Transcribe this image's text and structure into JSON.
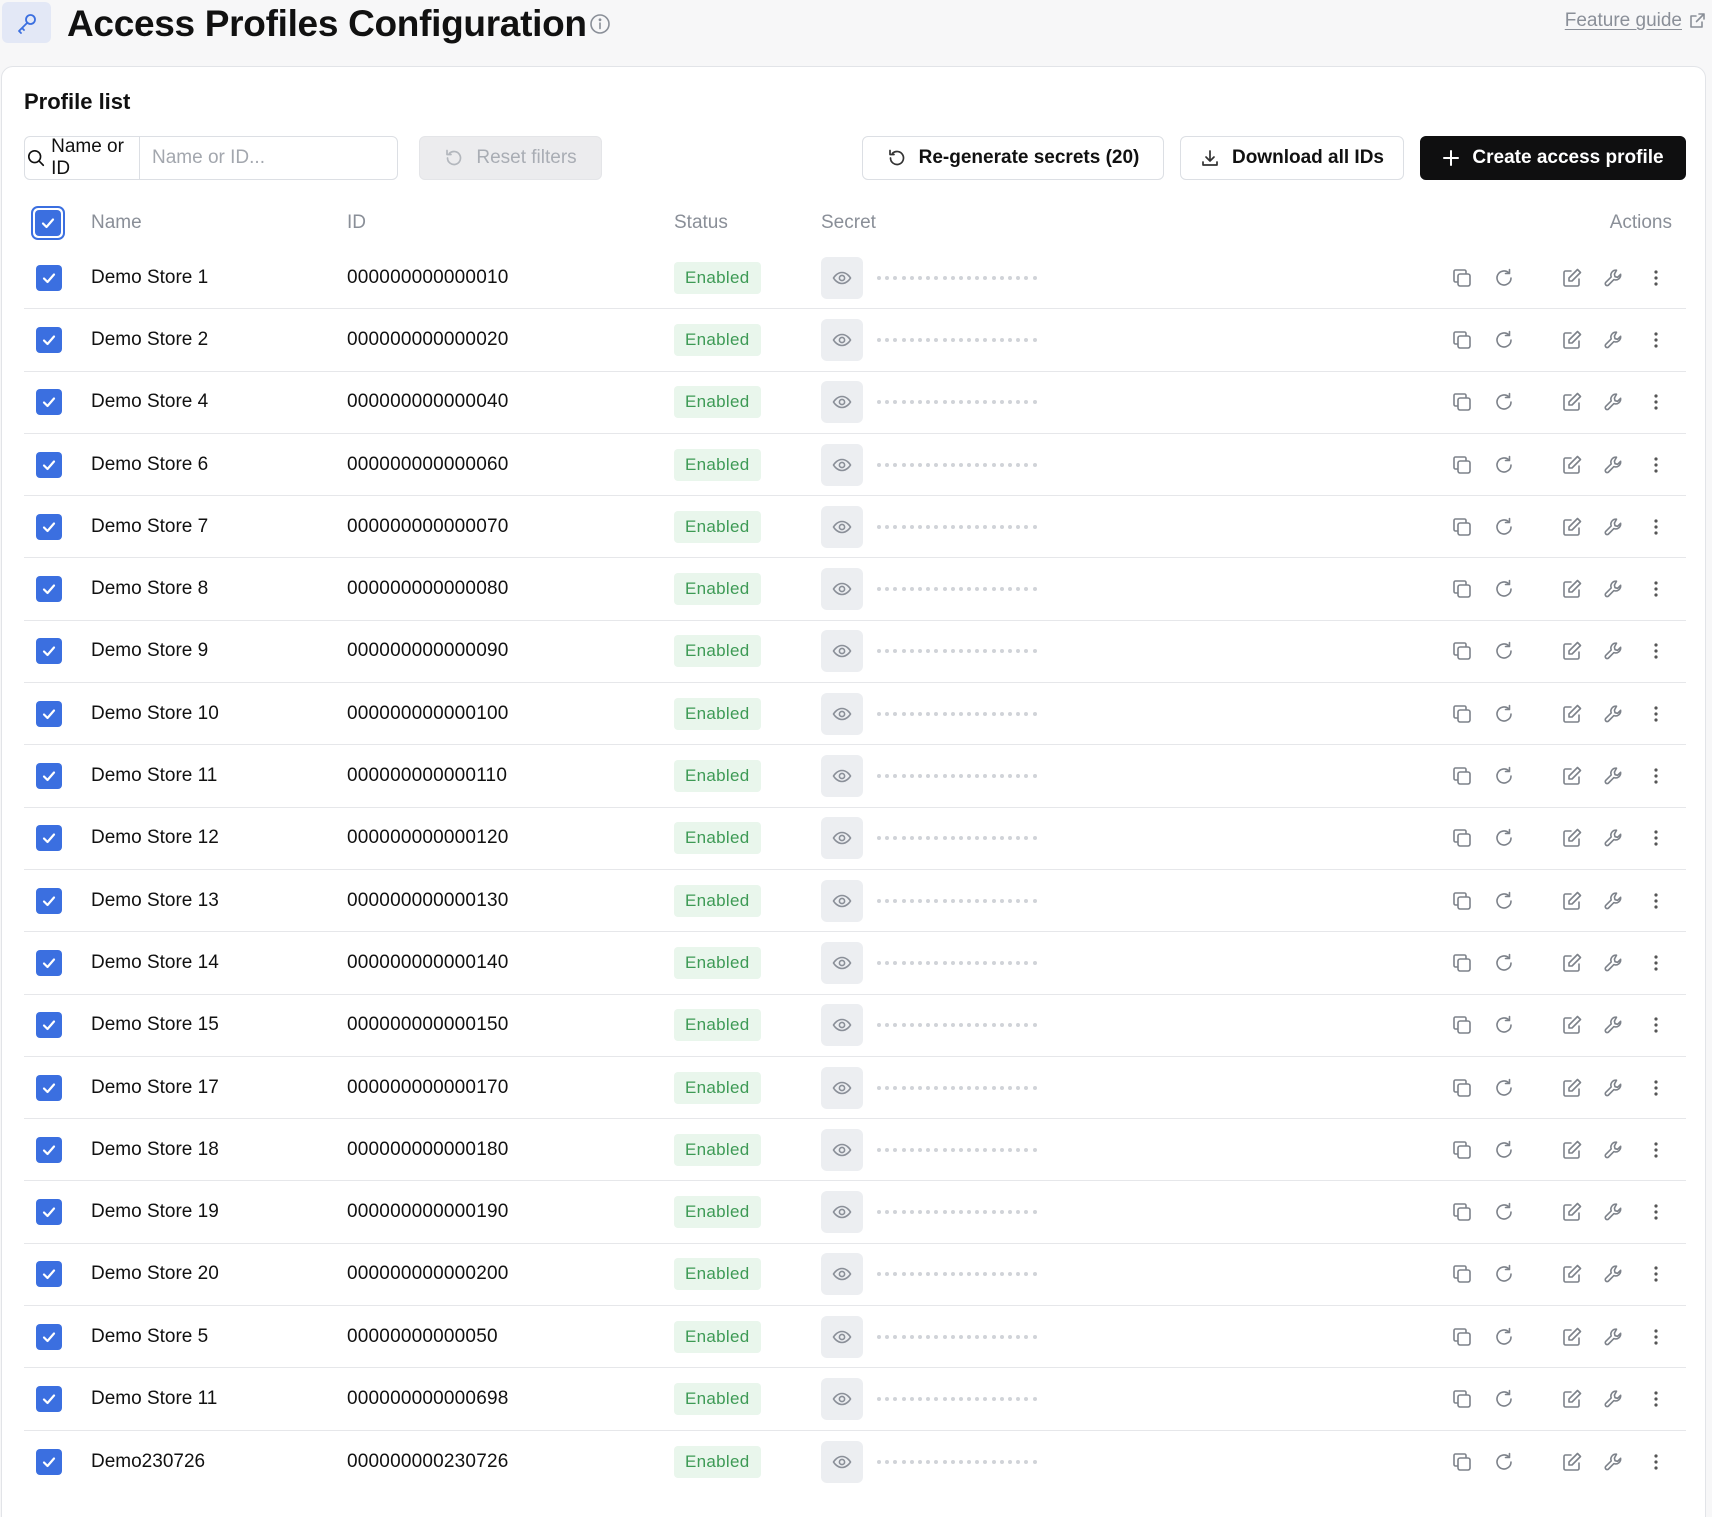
{
  "header": {
    "title": "Access Profiles Configuration",
    "feature_guide": "Feature guide"
  },
  "panel": {
    "title": "Profile list",
    "filter": {
      "type_label": "Name or ID",
      "placeholder": "Name or ID...",
      "value": ""
    },
    "buttons": {
      "reset": "Reset filters",
      "regenerate": "Re-generate secrets (20)",
      "download": "Download all IDs",
      "create": "Create access profile"
    }
  },
  "table": {
    "columns": {
      "name": "Name",
      "id": "ID",
      "status": "Status",
      "secret": "Secret",
      "actions": "Actions"
    },
    "rows": [
      {
        "name": "Demo Store 1",
        "id": "000000000000010",
        "status": "Enabled",
        "checked": true
      },
      {
        "name": "Demo Store 2",
        "id": "000000000000020",
        "status": "Enabled",
        "checked": true
      },
      {
        "name": "Demo Store 4",
        "id": "000000000000040",
        "status": "Enabled",
        "checked": true
      },
      {
        "name": "Demo Store 6",
        "id": "000000000000060",
        "status": "Enabled",
        "checked": true
      },
      {
        "name": "Demo Store 7",
        "id": "000000000000070",
        "status": "Enabled",
        "checked": true
      },
      {
        "name": "Demo Store 8",
        "id": "000000000000080",
        "status": "Enabled",
        "checked": true
      },
      {
        "name": "Demo Store 9",
        "id": "000000000000090",
        "status": "Enabled",
        "checked": true
      },
      {
        "name": "Demo Store 10",
        "id": "000000000000100",
        "status": "Enabled",
        "checked": true
      },
      {
        "name": "Demo Store 11",
        "id": "000000000000110",
        "status": "Enabled",
        "checked": true
      },
      {
        "name": "Demo Store 12",
        "id": "000000000000120",
        "status": "Enabled",
        "checked": true
      },
      {
        "name": "Demo Store 13",
        "id": "000000000000130",
        "status": "Enabled",
        "checked": true
      },
      {
        "name": "Demo Store 14",
        "id": "000000000000140",
        "status": "Enabled",
        "checked": true
      },
      {
        "name": "Demo Store 15",
        "id": "000000000000150",
        "status": "Enabled",
        "checked": true
      },
      {
        "name": "Demo Store 17",
        "id": "000000000000170",
        "status": "Enabled",
        "checked": true
      },
      {
        "name": "Demo Store 18",
        "id": "000000000000180",
        "status": "Enabled",
        "checked": true
      },
      {
        "name": "Demo Store 19",
        "id": "000000000000190",
        "status": "Enabled",
        "checked": true
      },
      {
        "name": "Demo Store 20",
        "id": "000000000000200",
        "status": "Enabled",
        "checked": true
      },
      {
        "name": "Demo Store 5",
        "id": "00000000000050",
        "status": "Enabled",
        "checked": true
      },
      {
        "name": "Demo Store 11",
        "id": "000000000000698",
        "status": "Enabled",
        "checked": true
      },
      {
        "name": "Demo230726",
        "id": "000000000230726",
        "status": "Enabled",
        "checked": true
      }
    ]
  },
  "icons": {
    "app": "key-icon",
    "info": "info-icon",
    "external": "external-link-icon",
    "search": "search-icon",
    "reset": "undo-icon",
    "regenerate": "refresh-icon",
    "download": "download-icon",
    "create": "plus-icon",
    "eye": "eye-icon",
    "copy": "copy-icon",
    "refresh": "refresh-icon",
    "edit": "edit-icon",
    "wrench": "wrench-icon",
    "more": "more-vertical-icon"
  },
  "colors": {
    "accent": "#3b6fe0",
    "primary_button": "#0f0f10",
    "status_enabled_bg": "#e9f6ec",
    "status_enabled_text": "#3d9a55"
  }
}
